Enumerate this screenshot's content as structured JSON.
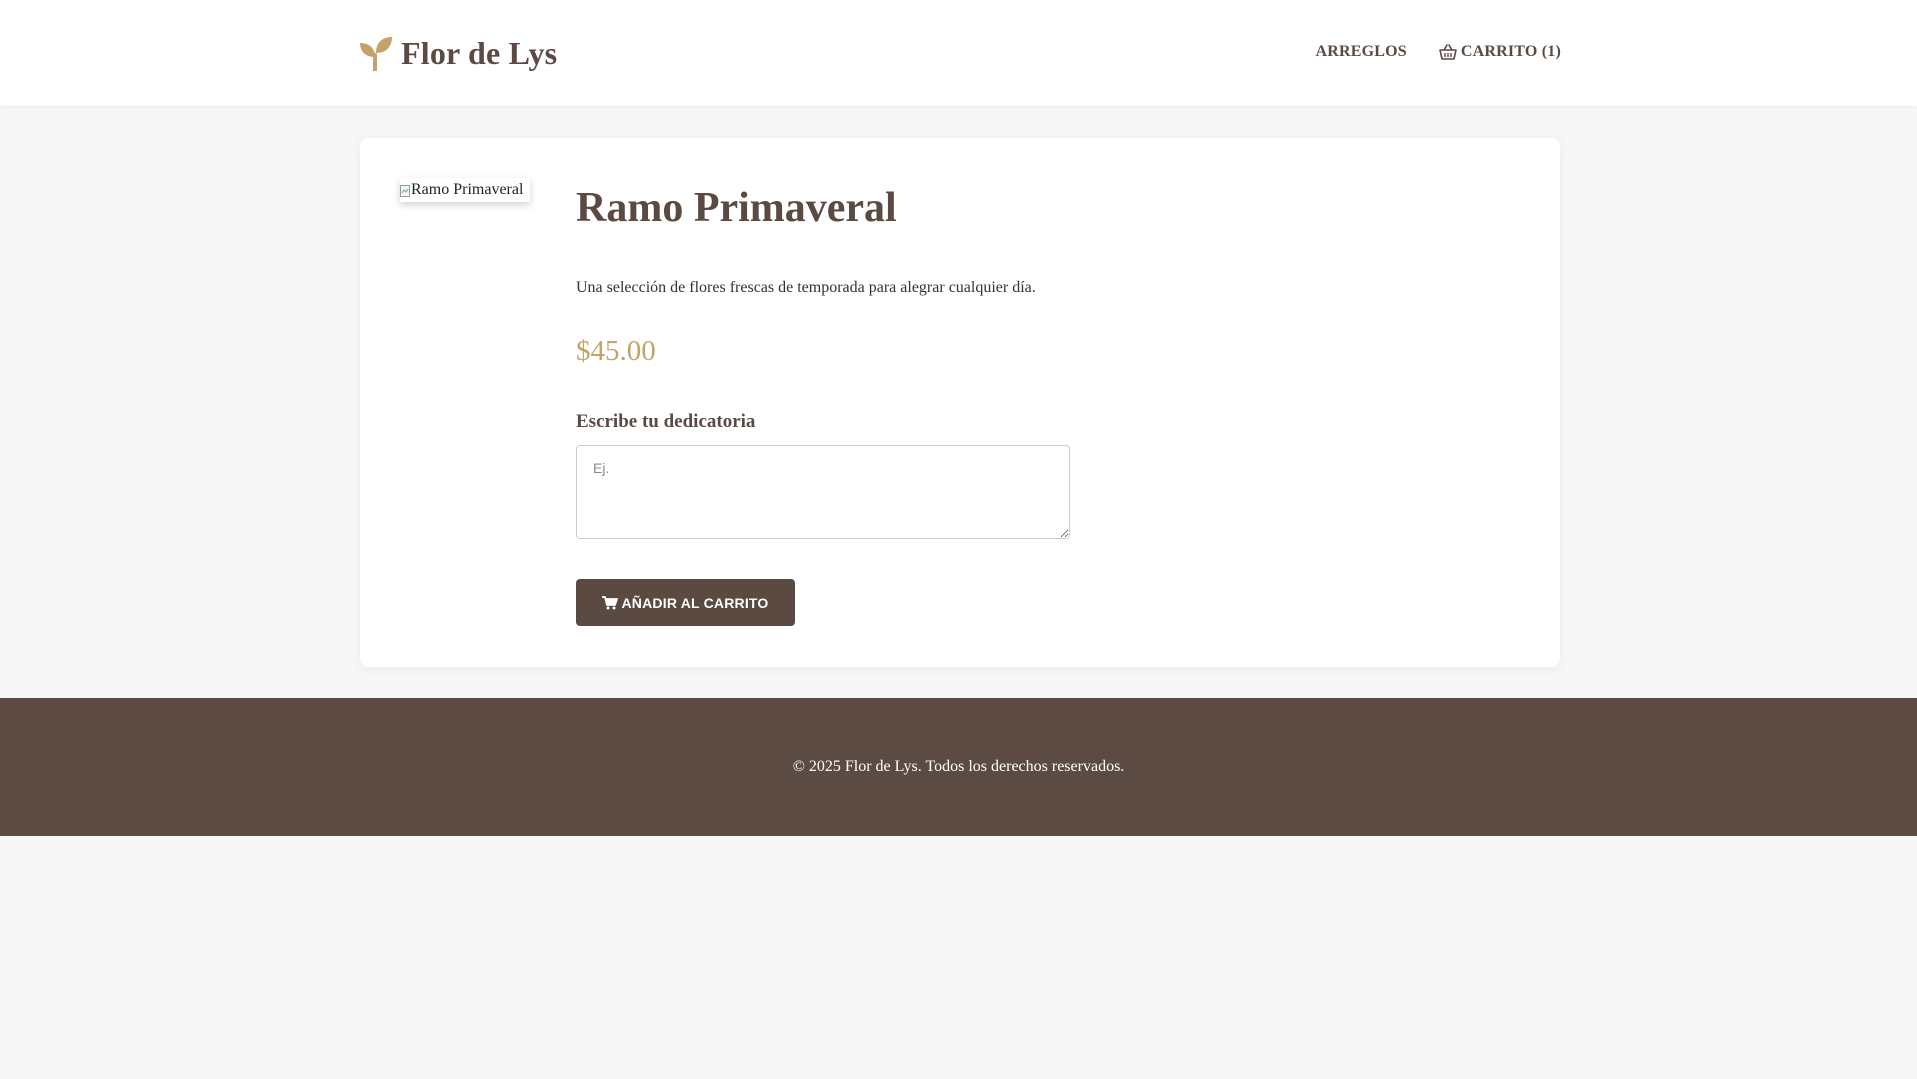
{
  "brand": {
    "name": "Flor de Lys",
    "accent_color": "#c4a26a",
    "primary_color": "#5b4a42",
    "logo_icon": "seedling-icon"
  },
  "nav": {
    "items": [
      {
        "label": "ARREGLOS"
      },
      {
        "label": "CARRITO (1)",
        "icon": "shopping-basket-icon"
      }
    ]
  },
  "product": {
    "image_alt": "Ramo Primaveral",
    "title": "Ramo Primaveral",
    "description": "Una selección de flores frescas de temporada para alegrar cualquier día.",
    "price": "$45.00",
    "dedication_label": "Escribe tu dedicatoria",
    "dedication_placeholder": "Ej.",
    "dedication_value": "",
    "add_to_cart_label": "AÑADIR AL CARRITO",
    "add_to_cart_icon": "shopping-cart-icon"
  },
  "footer": {
    "text": "© 2025 Flor de Lys. Todos los derechos reservados."
  }
}
